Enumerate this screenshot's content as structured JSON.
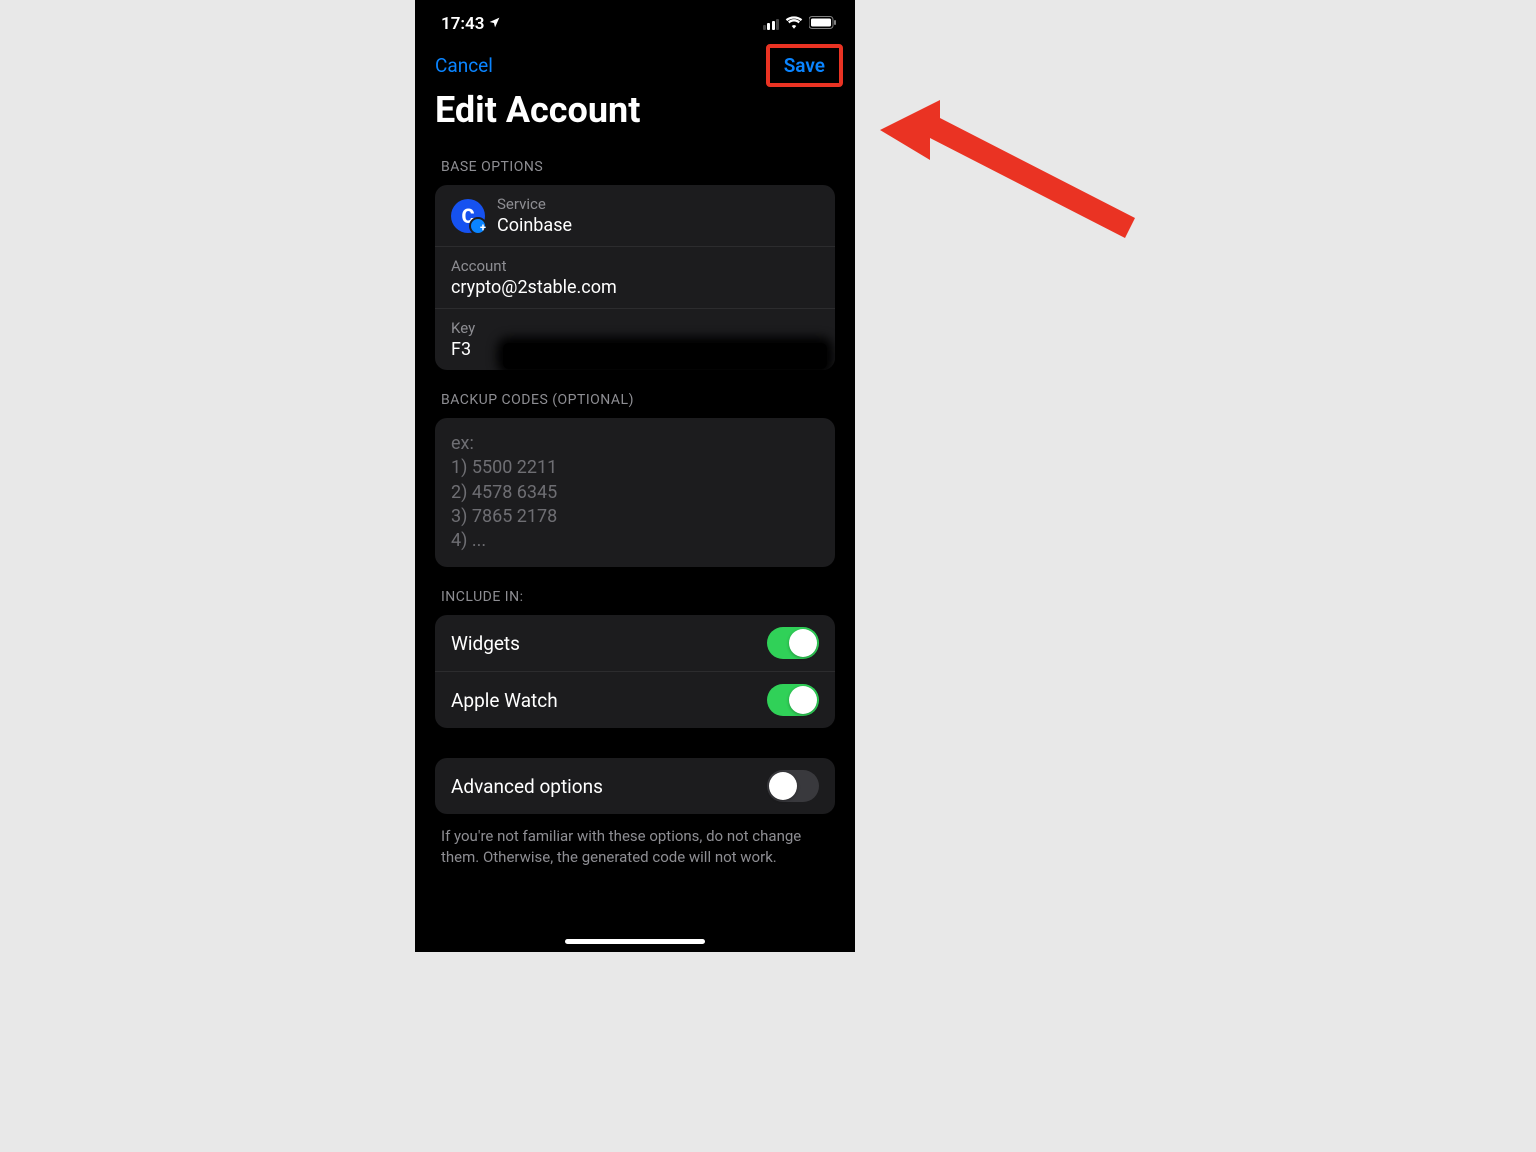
{
  "statusBar": {
    "time": "17:43"
  },
  "nav": {
    "cancel": "Cancel",
    "save": "Save"
  },
  "title": "Edit Account",
  "sections": {
    "baseOptions": {
      "header": "BASE OPTIONS",
      "serviceLabel": "Service",
      "serviceValue": "Coinbase",
      "accountLabel": "Account",
      "accountValue": "crypto@2stable.com",
      "keyLabel": "Key",
      "keyValue": "F3"
    },
    "backupCodes": {
      "header": "BACKUP CODES (OPTIONAL)",
      "placeholder": "ex:\n1) 5500 2211\n2) 4578 6345\n3) 7865 2178\n4) ..."
    },
    "includeIn": {
      "header": "INCLUDE IN:",
      "widgetsLabel": "Widgets",
      "appleWatchLabel": "Apple Watch"
    },
    "advanced": {
      "label": "Advanced options",
      "note": "If you're not familiar with these options, do not change them. Otherwise, the generated code will not work."
    }
  },
  "toggles": {
    "widgets": true,
    "appleWatch": true,
    "advanced": false
  },
  "annotation": {
    "highlightColor": "#ea3323"
  }
}
